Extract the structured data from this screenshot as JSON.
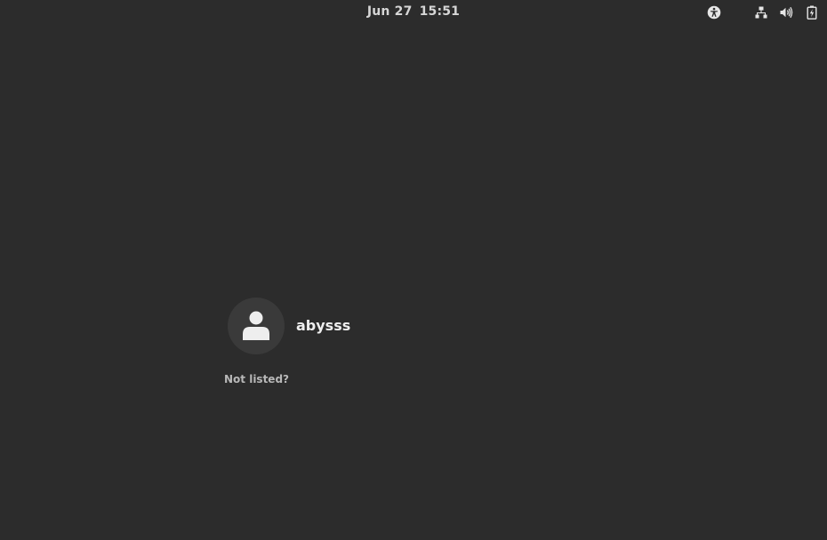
{
  "topbar": {
    "date": "Jun 27",
    "time": "15:51",
    "icons": [
      "accessibility-icon",
      "network-wired-icon",
      "volume-icon",
      "battery-charging-icon"
    ]
  },
  "login": {
    "users": [
      {
        "name": "abysss",
        "avatar_icon": "user-avatar-icon"
      }
    ],
    "not_listed_label": "Not listed?"
  },
  "colors": {
    "background": "#2c2c2c",
    "avatar_bg": "#3a3a3a",
    "text": "#eeeeee",
    "muted_text": "#b8b8b8"
  }
}
